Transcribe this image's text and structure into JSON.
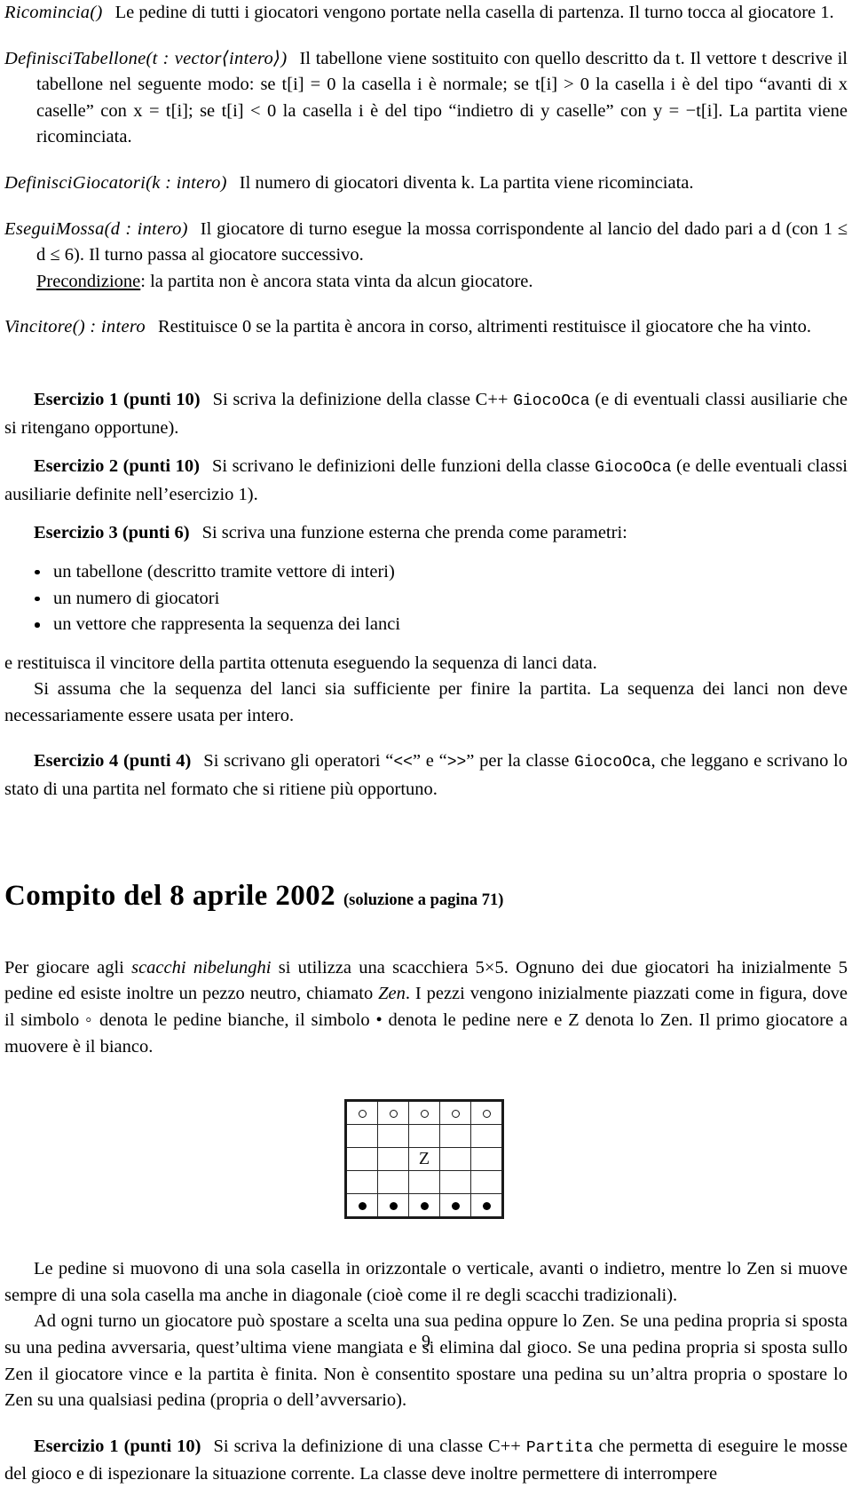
{
  "doc": {
    "page_number": "9"
  },
  "spec_methods": [
    {
      "signature_plain": "Ricomincia()",
      "body": "Le pedine di tutti i giocatori vengono portate nella casella di partenza. Il turno tocca al giocatore 1."
    },
    {
      "signature_plain": "DefinisciTabellone(t : vector⟨intero⟩)",
      "body": "Il tabellone viene sostituito con quello descritto da t. Il vettore t descrive il tabellone nel seguente modo: se t[i] = 0 la casella i è normale; se t[i] > 0 la casella i è del tipo “avanti di x caselle” con x = t[i]; se t[i] < 0 la casella i è del tipo “indietro di y caselle” con y = −t[i]. La partita viene ricominciata."
    },
    {
      "signature_plain": "DefinisciGiocatori(k : intero)",
      "body": "Il numero di giocatori diventa k. La partita viene ricominciata."
    },
    {
      "signature_plain": "EseguiMossa(d : intero)",
      "body": "Il giocatore di turno esegue la mossa corrispondente al lancio del dado pari a d (con 1 ≤ d ≤ 6). Il turno passa al giocatore successivo.",
      "precondition_label": "Precondizione",
      "precondition_text": "la partita non è ancora stata vinta da alcun giocatore."
    },
    {
      "signature_plain": "Vincitore() : intero",
      "body": "Restituisce 0 se la partita è ancora in corso, altrimenti restituisce il giocatore che ha vinto."
    }
  ],
  "exercises_oca": [
    {
      "label": "Esercizio 1 (punti 10)",
      "text_before": "Si scriva la definizione della classe C++ ",
      "code": "GiocoOca",
      "text_after": " (e di eventuali classi ausiliarie che si ritengano opportune)."
    },
    {
      "label": "Esercizio 2 (punti 10)",
      "text_before": "Si scrivano le definizioni delle funzioni della classe ",
      "code": "GiocoOca",
      "text_after": " (e delle eventuali classi ausiliarie definite nell’esercizio 1)."
    },
    {
      "label": "Esercizio 3 (punti 6)",
      "text_before": "Si scriva una funzione esterna che prenda come parametri:",
      "code": "",
      "text_after": ""
    }
  ],
  "exercise3_bullets": [
    "un tabellone (descritto tramite vettore di interi)",
    "un numero di giocatori",
    "un vettore che rappresenta la sequenza dei lanci"
  ],
  "exercise3_tail": {
    "line1": "e restituisca il vincitore della partita ottenuta eseguendo la sequenza di lanci data.",
    "line2": "Si assuma che la sequenza del lanci sia sufficiente per finire la partita. La sequenza dei lanci non deve necessariamente essere usata per intero."
  },
  "exercise4": {
    "label": "Esercizio 4 (punti 4)",
    "text_before": "Si scrivano gli operatori “",
    "op1": "<<",
    "text_mid1": "” e “",
    "op2": ">>",
    "text_mid2": "” per la classe ",
    "code": "GiocoOca",
    "text_after": ", che leggano e scrivano lo stato di una partita nel formato che si ritiene più opportuno."
  },
  "section": {
    "title": "Compito del 8 aprile 2002",
    "subtitle": "(soluzione a pagina 71)"
  },
  "intro": {
    "p1_a": "Per giocare agli ",
    "p1_em": "scacchi nibelunghi",
    "p1_b": " si utilizza una scacchiera 5×5. Ognuno dei due giocatori ha inizialmente 5 pedine ed esiste inoltre un pezzo neutro, chiamato ",
    "p1_em2": "Zen",
    "p1_c": ". I pezzi vengono inizialmente piazzati come in figura, dove il simbolo ◦ denota le pedine bianche, il simbolo • denota le pedine nere e Z denota lo Zen. Il primo giocatore a muovere è il bianco."
  },
  "board": {
    "rows": 5,
    "cols": 5,
    "cells": [
      [
        "white",
        "white",
        "white",
        "white",
        "white"
      ],
      [
        "",
        "",
        "",
        "",
        ""
      ],
      [
        "",
        "",
        "zen",
        "",
        ""
      ],
      [
        "",
        "",
        "",
        "",
        ""
      ],
      [
        "black",
        "black",
        "black",
        "black",
        "black"
      ]
    ],
    "zen_label": "Z"
  },
  "rules": {
    "p1": "Le pedine si muovono di una sola casella in orizzontale o verticale, avanti o indietro, mentre lo Zen si muove sempre di una sola casella ma anche in diagonale (cioè come il re degli scacchi tradizionali).",
    "p2": "Ad ogni turno un giocatore può spostare a scelta una sua pedina oppure lo Zen. Se una pedina propria si sposta su una pedina avversaria, quest’ultima viene mangiata e si elimina dal gioco. Se una pedina propria si sposta sullo Zen il giocatore vince e la partita è finita. Non è consentito spostare una pedina su un’altra propria o spostare lo Zen su una qualsiasi pedina (propria o dell’avversario)."
  },
  "exercise_partita": {
    "label": "Esercizio 1 (punti 10)",
    "text_before": "Si scriva la definizione di una classe C++ ",
    "code": "Partita",
    "text_after": " che permetta di eseguire le mosse del gioco e di ispezionare la situazione corrente. La classe deve inoltre permettere di interrompere"
  }
}
